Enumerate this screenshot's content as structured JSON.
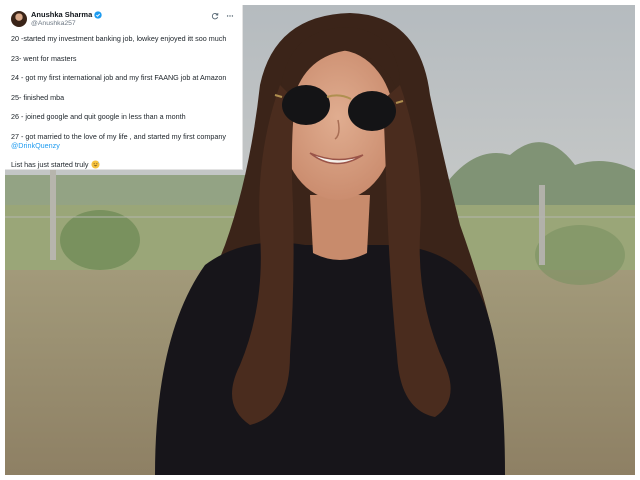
{
  "tweet": {
    "display_name": "Anushka Sharma",
    "handle": "@Anushka257",
    "icons": {
      "verified": "verified-badge-icon",
      "refresh": "refresh-icon",
      "more": "more-options-icon",
      "emoji": "grinning-sweat-emoji-icon"
    },
    "lines": [
      "20 -started my investment banking job, lowkey enjoyed itt soo much",
      "23- went for masters",
      "24 - got my first international job and my first FAANG job at Amazon",
      "25- finished mba",
      "26 - joined google and quit google in less than a month",
      "27 - got married to the love of my life , and started my first company"
    ],
    "mention": "@DrinkQuenzy",
    "closing": "List has just started truly"
  },
  "colors": {
    "verified_blue": "#1d9bf0",
    "mention_blue": "#1d9bf0",
    "text_primary": "#0f1419",
    "text_secondary": "#6b7682"
  },
  "photo": {
    "icon": "portrait-photo"
  }
}
